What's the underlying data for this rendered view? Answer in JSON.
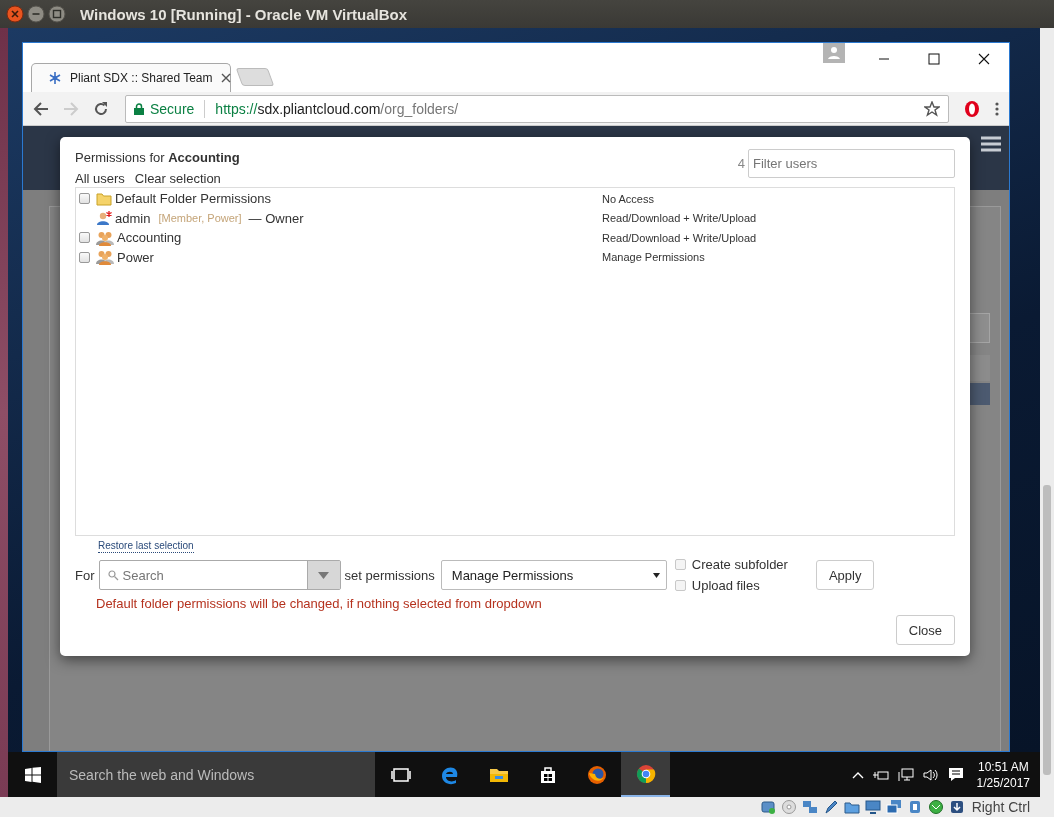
{
  "vm_window": {
    "title": "Windows 10 [Running] - Oracle VM VirtualBox"
  },
  "browser": {
    "tabs": [
      {
        "title": "Pliant SDX :: Shared Team",
        "selected": true
      }
    ],
    "address": {
      "security": "Secure",
      "scheme": "https://",
      "host": "sdx.pliantcloud.com",
      "path": "/org_folders/"
    }
  },
  "dialog": {
    "title": "Permissions for **Accounting**",
    "filter_count": "4",
    "filter_placeholder": "Filter users",
    "links": [
      "All users",
      "Clear selection"
    ],
    "entries": [
      {
        "kind": "folder",
        "checked": false,
        "name": "Default Folder Permissions",
        "permission": "No Access"
      },
      {
        "kind": "user",
        "name": "admin",
        "roles": "[Member, Power]",
        "note": "— Owner",
        "permission": "Read/Download + Write/Upload"
      },
      {
        "kind": "group",
        "checked": false,
        "name": "Accounting",
        "permission": "Read/Download + Write/Upload"
      },
      {
        "kind": "group",
        "checked": false,
        "name": "Power",
        "permission": "Manage Permissions"
      }
    ],
    "restore_link": "Restore last selection",
    "for_label": "For",
    "search_placeholder": "Search",
    "set_label": "set permissions",
    "permission_select": "Manage Permissions",
    "options": [
      {
        "label": "Create subfolder",
        "checked": false
      },
      {
        "label": "Upload files",
        "checked": false
      }
    ],
    "apply": "Apply",
    "warning": "Default folder permissions will be changed, if nothing selected from dropdown",
    "close": "Close"
  },
  "taskbar": {
    "search_placeholder": "Search the web and Windows",
    "apps": [
      {
        "kind": "task-view",
        "selected": false
      },
      {
        "kind": "edge",
        "selected": false
      },
      {
        "kind": "explorer",
        "selected": false
      },
      {
        "kind": "store",
        "selected": false
      },
      {
        "kind": "firefox",
        "selected": false
      },
      {
        "kind": "chrome",
        "selected": true
      }
    ],
    "clock": {
      "time": "10:51 AM",
      "date": "1/25/2017"
    }
  },
  "vbox_status": {
    "host_key": "Right Ctrl"
  }
}
